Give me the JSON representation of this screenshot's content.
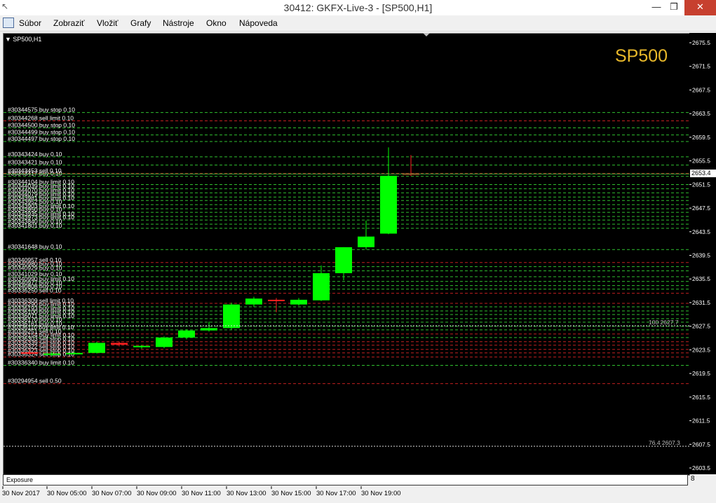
{
  "window": {
    "title": "30412: GKFX-Live-3 - [SP500,H1]",
    "minimize": "—",
    "restore": "❐",
    "close": "✕"
  },
  "menu": [
    "Súbor",
    "Zobraziť",
    "Vložiť",
    "Grafy",
    "Nástroje",
    "Okno",
    "Nápoveda"
  ],
  "chart": {
    "symbol_label": "▼ SP500,H1",
    "watermark": "SP500",
    "current_price": "2653.4",
    "fib_upper": {
      "level": "100",
      "price": "2627.7",
      "value": 2627.7
    },
    "fib_lower": {
      "level": "76.4",
      "price": "2607.3",
      "value": 2607.3
    },
    "bottom_tab": "Exposure",
    "colors": {
      "bg": "#000000",
      "bull": "#00ff00",
      "bear": "#ff2020",
      "order_line_green": "#2fbf2f",
      "order_line_red": "#c02020",
      "watermark": "#e8b82a"
    }
  },
  "chart_data": {
    "type": "candlestick",
    "y_ticks": [
      "2675.5",
      "2671.5",
      "2667.5",
      "2663.5",
      "2659.5",
      "2655.5",
      "2651.5",
      "2647.5",
      "2643.5",
      "2639.5",
      "2635.5",
      "2631.5",
      "2627.5",
      "2623.5",
      "2619.5",
      "2615.5",
      "2611.5",
      "2607.5",
      "2603.5"
    ],
    "y_tick_values": [
      2675.5,
      2671.5,
      2667.5,
      2663.5,
      2659.5,
      2655.5,
      2651.5,
      2647.5,
      2643.5,
      2639.5,
      2635.5,
      2631.5,
      2627.5,
      2623.5,
      2619.5,
      2615.5,
      2611.5,
      2607.5,
      2603.5
    ],
    "x_ticks": [
      "30 Nov 2017",
      "30 Nov 05:00",
      "30 Nov 07:00",
      "30 Nov 09:00",
      "30 Nov 11:00",
      "30 Nov 13:00",
      "30 Nov 15:00",
      "30 Nov 17:00",
      "30 Nov 19:00"
    ],
    "candles": [
      {
        "o": 2623.2,
        "h": 2623.6,
        "l": 2622.8,
        "c": 2623.0
      },
      {
        "o": 2622.8,
        "h": 2623.3,
        "l": 2622.5,
        "c": 2623.0
      },
      {
        "o": 2623.0,
        "h": 2623.3,
        "l": 2622.9,
        "c": 2623.1
      },
      {
        "o": 2623.1,
        "h": 2625.0,
        "l": 2623.0,
        "c": 2624.8
      },
      {
        "o": 2624.8,
        "h": 2625.0,
        "l": 2624.2,
        "c": 2624.5
      },
      {
        "o": 2624.2,
        "h": 2624.4,
        "l": 2623.8,
        "c": 2624.3
      },
      {
        "o": 2624.1,
        "h": 2625.9,
        "l": 2623.9,
        "c": 2625.7
      },
      {
        "o": 2625.7,
        "h": 2627.1,
        "l": 2625.4,
        "c": 2626.9
      },
      {
        "o": 2626.9,
        "h": 2628.4,
        "l": 2626.7,
        "c": 2627.3
      },
      {
        "o": 2627.3,
        "h": 2631.6,
        "l": 2627.0,
        "c": 2631.3
      },
      {
        "o": 2631.3,
        "h": 2632.6,
        "l": 2630.9,
        "c": 2632.3
      },
      {
        "o": 2632.1,
        "h": 2632.4,
        "l": 2630.0,
        "c": 2632.0
      },
      {
        "o": 2631.3,
        "h": 2632.4,
        "l": 2631.1,
        "c": 2632.1
      },
      {
        "o": 2632.0,
        "h": 2637.9,
        "l": 2631.9,
        "c": 2636.6
      },
      {
        "o": 2636.6,
        "h": 2641.0,
        "l": 2635.4,
        "c": 2641.0
      },
      {
        "o": 2641.0,
        "h": 2645.5,
        "l": 2640.6,
        "c": 2642.8
      },
      {
        "o": 2643.3,
        "h": 2657.9,
        "l": 2643.2,
        "c": 2653.1
      },
      {
        "o": 2653.5,
        "h": 2656.6,
        "l": 2653.1,
        "c": 2653.4
      }
    ],
    "bid_line": 2653.4
  },
  "orders": [
    {
      "label": "#30344575 buy stop 0.10",
      "price": 2663.8,
      "side": "buy"
    },
    {
      "label": "#30344268 sell limit 0.10",
      "price": 2662.4,
      "side": "sell"
    },
    {
      "label": "#30344500 buy stop 0.10",
      "price": 2661.2,
      "side": "buy"
    },
    {
      "label": "#30344499 buy stop 0.10",
      "price": 2660.0,
      "side": "buy"
    },
    {
      "label": "#30344497 buy stop 0.10",
      "price": 2658.9,
      "side": "buy"
    },
    {
      "label": "#30343424 buy 0.10",
      "price": 2656.3,
      "side": "buy"
    },
    {
      "label": "#30343421 buy 0.10",
      "price": 2654.9,
      "side": "buy"
    },
    {
      "label": "#30343453 sell 0.10",
      "price": 2653.5,
      "side": "sell"
    },
    {
      "label": "#30343417 buy 0.10",
      "price": 2653.0,
      "side": "buy"
    },
    {
      "label": "#30344104 buy limit 0.10",
      "price": 2651.6,
      "side": "buy"
    },
    {
      "label": "#30344039 buy limit 0.10",
      "price": 2650.9,
      "side": "buy"
    },
    {
      "label": "#30344070 buy limit 0.10",
      "price": 2650.2,
      "side": "buy"
    },
    {
      "label": "#30344079 buy limit 0.10",
      "price": 2649.5,
      "side": "buy"
    },
    {
      "label": "#30343981 buy limit 0.10",
      "price": 2648.9,
      "side": "buy"
    },
    {
      "label": "#30343952 buy 0.10",
      "price": 2648.2,
      "side": "buy"
    },
    {
      "label": "#30343903 buy limit 0.10",
      "price": 2647.5,
      "side": "buy"
    },
    {
      "label": "#30343950 buy 0.10",
      "price": 2646.9,
      "side": "buy"
    },
    {
      "label": "#30343935 buy limit 0.10",
      "price": 2646.2,
      "side": "buy"
    },
    {
      "label": "#30343973 buy limit 0.10",
      "price": 2645.6,
      "side": "buy"
    },
    {
      "label": "#30343840 buy 0.10",
      "price": 2644.9,
      "side": "buy"
    },
    {
      "label": "#30341801 buy 0.10",
      "price": 2644.2,
      "side": "buy"
    },
    {
      "label": "#30341648 buy 0.10",
      "price": 2640.6,
      "side": "buy"
    },
    {
      "label": "#30340957 sell 0.10",
      "price": 2638.4,
      "side": "sell"
    },
    {
      "label": "#30340980 buy 0.10",
      "price": 2637.7,
      "side": "buy"
    },
    {
      "label": "#30340929 buy 0.10",
      "price": 2637.0,
      "side": "buy"
    },
    {
      "label": "#30341029 buy 0.10",
      "price": 2636.0,
      "side": "buy"
    },
    {
      "label": "#30340990 buy limit 0.10",
      "price": 2635.2,
      "side": "buy"
    },
    {
      "label": "#30340977 buy 0.10",
      "price": 2634.5,
      "side": "buy"
    },
    {
      "label": "#30340808 buy 0.10",
      "price": 2633.9,
      "side": "buy"
    },
    {
      "label": "#30336250 sell 0.10",
      "price": 2633.2,
      "side": "sell"
    },
    {
      "label": "#30336309 sell limit 0.10",
      "price": 2631.5,
      "side": "sell"
    },
    {
      "label": "#30336290 buy limit 0.10",
      "price": 2630.9,
      "side": "buy"
    },
    {
      "label": "#30336193 buy limit 0.10",
      "price": 2630.2,
      "side": "buy"
    },
    {
      "label": "#30336100 buy limit 0.10",
      "price": 2629.6,
      "side": "buy"
    },
    {
      "label": "#30336071 buy limit 0.10",
      "price": 2628.9,
      "side": "buy"
    },
    {
      "label": "#30336170 buy 0.10",
      "price": 2628.3,
      "side": "buy"
    },
    {
      "label": "#30336161 buy 0.10",
      "price": 2627.6,
      "side": "buy"
    },
    {
      "label": "#30336110 buy limit 0.10",
      "price": 2627.0,
      "side": "buy"
    },
    {
      "label": "#30336251 sell 0.10",
      "price": 2626.3,
      "side": "sell"
    },
    {
      "label": "#30336154 buy limit 0.10",
      "price": 2625.7,
      "side": "buy"
    },
    {
      "label": "#30336303 sell stop 0.10",
      "price": 2625.0,
      "side": "sell"
    },
    {
      "label": "#30336339 sell stop 0.10",
      "price": 2624.4,
      "side": "sell"
    },
    {
      "label": "#30336322 sell stop 0.10",
      "price": 2623.7,
      "side": "sell"
    },
    {
      "label": "#30336323 sell stop 0.10",
      "price": 2623.1,
      "side": "sell"
    },
    {
      "label": "#30336324 sell stop 0.10",
      "price": 2622.4,
      "side": "sell"
    },
    {
      "label": "#30336340 buy limit 0.10",
      "price": 2621.0,
      "side": "buy"
    },
    {
      "label": "#30294954 sell 0.50",
      "price": 2617.9,
      "side": "sell"
    }
  ]
}
